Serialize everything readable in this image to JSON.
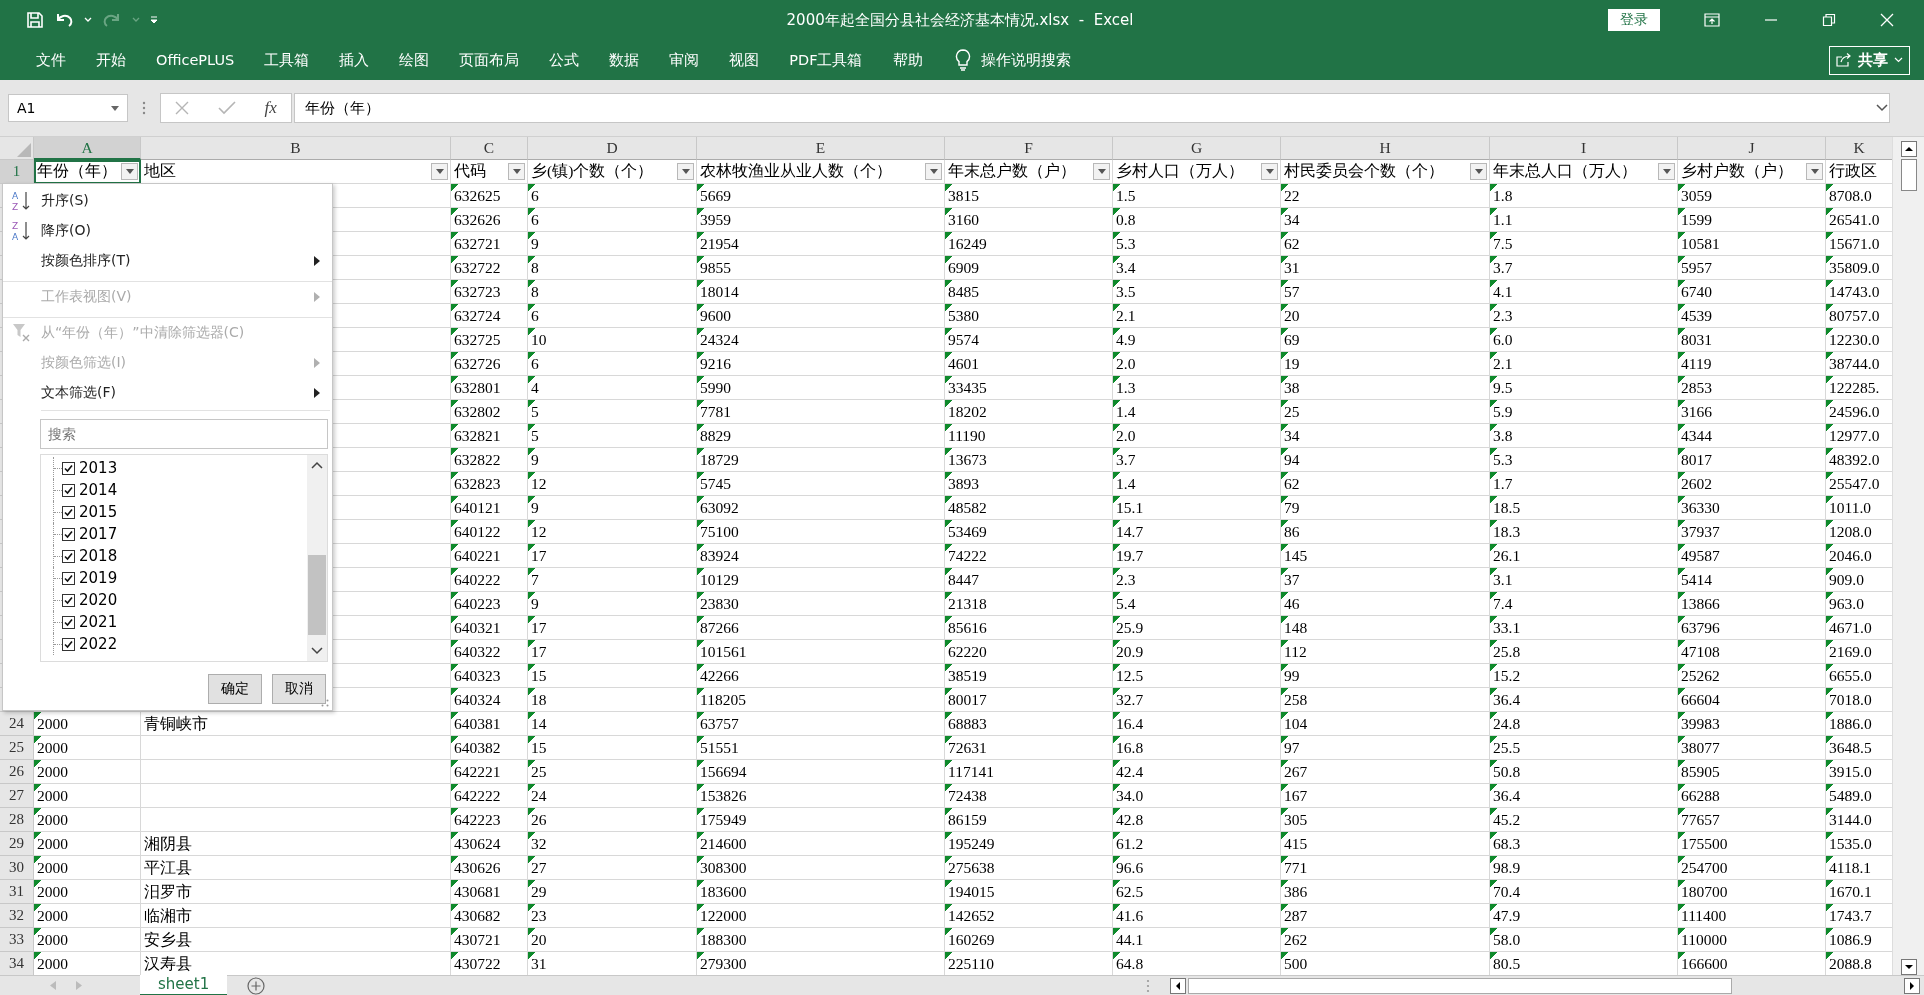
{
  "window": {
    "title": "2000年起全国分县社会经济基本情况.xlsx  -  Excel",
    "login": "登录"
  },
  "ribbon": {
    "tabs": [
      {
        "label": "文件",
        "selected": false
      },
      {
        "label": "开始",
        "selected": false
      },
      {
        "label": "OfficePLUS",
        "selected": false
      },
      {
        "label": "工具箱",
        "selected": false
      },
      {
        "label": "插入",
        "selected": false
      },
      {
        "label": "绘图",
        "selected": false
      },
      {
        "label": "页面布局",
        "selected": false
      },
      {
        "label": "公式",
        "selected": false
      },
      {
        "label": "数据",
        "selected": false
      },
      {
        "label": "审阅",
        "selected": false
      },
      {
        "label": "视图",
        "selected": false
      },
      {
        "label": "PDF工具箱",
        "selected": false
      },
      {
        "label": "帮助",
        "selected": false
      }
    ],
    "tell_me": "操作说明搜索",
    "share": "共享"
  },
  "formula_bar": {
    "name_box": "A1",
    "fx": "fx",
    "formula": "年份（年）"
  },
  "columns": [
    {
      "letter": "A",
      "header": "年份（年）",
      "selected": true,
      "filter_button": true,
      "text_number": true
    },
    {
      "letter": "B",
      "header": "地区",
      "selected": false,
      "filter_button": true,
      "text_number": false
    },
    {
      "letter": "C",
      "header": "代码",
      "selected": false,
      "filter_button": true,
      "text_number": true
    },
    {
      "letter": "D",
      "header": "乡(镇)个数（个）",
      "selected": false,
      "filter_button": true,
      "text_number": true
    },
    {
      "letter": "E",
      "header": "农林牧渔业从业人数（个）",
      "selected": false,
      "filter_button": true,
      "text_number": true
    },
    {
      "letter": "F",
      "header": "年末总户数（户）",
      "selected": false,
      "filter_button": true,
      "text_number": true
    },
    {
      "letter": "G",
      "header": "乡村人口（万人）",
      "selected": false,
      "filter_button": true,
      "text_number": true
    },
    {
      "letter": "H",
      "header": "村民委员会个数（个）",
      "selected": false,
      "filter_button": true,
      "text_number": true
    },
    {
      "letter": "I",
      "header": "年末总人口（万人）",
      "selected": false,
      "filter_button": true,
      "text_number": true
    },
    {
      "letter": "J",
      "header": "乡村户数（户）",
      "selected": false,
      "filter_button": true,
      "text_number": true
    },
    {
      "letter": "K",
      "header": "行政区",
      "selected": false,
      "text_number": true
    }
  ],
  "header_row_number": "1",
  "rows": [
    {
      "values": [
        "632625",
        "6",
        "5669",
        "3815",
        "1.5",
        "22",
        "1.8",
        "3059",
        "8708.0"
      ]
    },
    {
      "values": [
        "632626",
        "6",
        "3959",
        "3160",
        "0.8",
        "34",
        "1.1",
        "1599",
        "26541.0"
      ]
    },
    {
      "values": [
        "632721",
        "9",
        "21954",
        "16249",
        "5.3",
        "62",
        "7.5",
        "10581",
        "15671.0"
      ]
    },
    {
      "values": [
        "632722",
        "8",
        "9855",
        "6909",
        "3.4",
        "31",
        "3.7",
        "5957",
        "35809.0"
      ]
    },
    {
      "values": [
        "632723",
        "8",
        "18014",
        "8485",
        "3.5",
        "57",
        "4.1",
        "6740",
        "14743.0"
      ]
    },
    {
      "values": [
        "632724",
        "6",
        "9600",
        "5380",
        "2.1",
        "20",
        "2.3",
        "4539",
        "80757.0"
      ]
    },
    {
      "values": [
        "632725",
        "10",
        "24324",
        "9574",
        "4.9",
        "69",
        "6.0",
        "8031",
        "12230.0"
      ]
    },
    {
      "values": [
        "632726",
        "6",
        "9216",
        "4601",
        "2.0",
        "19",
        "2.1",
        "4119",
        "38744.0"
      ]
    },
    {
      "values": [
        "632801",
        "4",
        "5990",
        "33435",
        "1.3",
        "38",
        "9.5",
        "2853",
        "122285."
      ]
    },
    {
      "values": [
        "632802",
        "5",
        "7781",
        "18202",
        "1.4",
        "25",
        "5.9",
        "3166",
        "24596.0"
      ]
    },
    {
      "values": [
        "632821",
        "5",
        "8829",
        "11190",
        "2.0",
        "34",
        "3.8",
        "4344",
        "12977.0"
      ]
    },
    {
      "values": [
        "632822",
        "9",
        "18729",
        "13673",
        "3.7",
        "94",
        "5.3",
        "8017",
        "48392.0"
      ]
    },
    {
      "values": [
        "632823",
        "12",
        "5745",
        "3893",
        "1.4",
        "62",
        "1.7",
        "2602",
        "25547.0"
      ]
    },
    {
      "values": [
        "640121",
        "9",
        "63092",
        "48582",
        "15.1",
        "79",
        "18.5",
        "36330",
        "1011.0"
      ]
    },
    {
      "values": [
        "640122",
        "12",
        "75100",
        "53469",
        "14.7",
        "86",
        "18.3",
        "37937",
        "1208.0"
      ]
    },
    {
      "values": [
        "640221",
        "17",
        "83924",
        "74222",
        "19.7",
        "145",
        "26.1",
        "49587",
        "2046.0"
      ]
    },
    {
      "values": [
        "640222",
        "7",
        "10129",
        "8447",
        "2.3",
        "37",
        "3.1",
        "5414",
        "909.0"
      ]
    },
    {
      "values": [
        "640223",
        "9",
        "23830",
        "21318",
        "5.4",
        "46",
        "7.4",
        "13866",
        "963.0"
      ]
    },
    {
      "values": [
        "640321",
        "17",
        "87266",
        "85616",
        "25.9",
        "148",
        "33.1",
        "63796",
        "4671.0"
      ]
    },
    {
      "values": [
        "640322",
        "17",
        "101561",
        "62220",
        "20.9",
        "112",
        "25.8",
        "47108",
        "2169.0"
      ]
    },
    {
      "values": [
        "640323",
        "15",
        "42266",
        "38519",
        "12.5",
        "99",
        "15.2",
        "25262",
        "6655.0"
      ]
    },
    {
      "values": [
        "640324",
        "18",
        "118205",
        "80017",
        "32.7",
        "258",
        "36.4",
        "66604",
        "7018.0"
      ]
    },
    {
      "number": "24",
      "year": "2000",
      "region": "青铜峡市",
      "values": [
        "640381",
        "14",
        "63757",
        "68883",
        "16.4",
        "104",
        "24.8",
        "39983",
        "1886.0"
      ]
    },
    {
      "number": "25",
      "year": "2000",
      "values": [
        "640382",
        "15",
        "51551",
        "72631",
        "16.8",
        "97",
        "25.5",
        "38077",
        "3648.5"
      ]
    },
    {
      "number": "26",
      "year": "2000",
      "values": [
        "642221",
        "25",
        "156694",
        "117141",
        "42.4",
        "267",
        "50.8",
        "85905",
        "3915.0"
      ]
    },
    {
      "number": "27",
      "year": "2000",
      "values": [
        "642222",
        "24",
        "153826",
        "72438",
        "34.0",
        "167",
        "36.4",
        "66288",
        "5489.0"
      ]
    },
    {
      "number": "28",
      "year": "2000",
      "values": [
        "642223",
        "26",
        "175949",
        "86159",
        "42.8",
        "305",
        "45.2",
        "77657",
        "3144.0"
      ]
    },
    {
      "number": "29",
      "year": "2000",
      "region": "湘阴县",
      "values": [
        "430624",
        "32",
        "214600",
        "195249",
        "61.2",
        "415",
        "68.3",
        "175500",
        "1535.0"
      ]
    },
    {
      "number": "30",
      "year": "2000",
      "region": "平江县",
      "values": [
        "430626",
        "27",
        "308300",
        "275638",
        "96.6",
        "771",
        "98.9",
        "254700",
        "4118.1"
      ]
    },
    {
      "number": "31",
      "year": "2000",
      "region": "汨罗市",
      "values": [
        "430681",
        "29",
        "183600",
        "194015",
        "62.5",
        "386",
        "70.4",
        "180700",
        "1670.1"
      ]
    },
    {
      "number": "32",
      "year": "2000",
      "region": "临湘市",
      "values": [
        "430682",
        "23",
        "122000",
        "142652",
        "41.6",
        "287",
        "47.9",
        "111400",
        "1743.7"
      ]
    },
    {
      "number": "33",
      "year": "2000",
      "region": "安乡县",
      "values": [
        "430721",
        "20",
        "188300",
        "160269",
        "44.1",
        "262",
        "58.0",
        "110000",
        "1086.9"
      ]
    },
    {
      "number": "34",
      "year": "2000",
      "region": "汉寿县",
      "values": [
        "430722",
        "31",
        "279300",
        "225110",
        "64.8",
        "500",
        "80.5",
        "166600",
        "2088.8"
      ]
    }
  ],
  "filter_menu": {
    "items": [
      {
        "kind": "sort-ascending",
        "icon_text": [
          "A",
          "Z"
        ],
        "label": "升序(S)",
        "disabled": false,
        "submenu": false,
        "separator_before": false
      },
      {
        "kind": "sort-descending",
        "icon_text": [
          "Z",
          "A"
        ],
        "label": "降序(O)",
        "disabled": false,
        "submenu": false,
        "separator_before": false
      },
      {
        "kind": "plain",
        "label": "按颜色排序(T)",
        "disabled": false,
        "submenu": true,
        "separator_before": false
      },
      {
        "kind": "plain",
        "label": "工作表视图(V)",
        "disabled": true,
        "submenu": true,
        "separator_before": true
      },
      {
        "kind": "clear-filter",
        "label": "从“年份（年）”中清除筛选器(C)",
        "disabled": true,
        "submenu": false,
        "separator_before": true
      },
      {
        "kind": "plain",
        "label": "按颜色筛选(I)",
        "disabled": true,
        "submenu": true,
        "separator_before": false
      },
      {
        "kind": "plain",
        "label": "文本筛选(F)",
        "disabled": false,
        "submenu": true,
        "separator_before": false
      }
    ],
    "search_placeholder": "搜索",
    "options": [
      {
        "label": "2013",
        "checked": true
      },
      {
        "label": "2014",
        "checked": true
      },
      {
        "label": "2015",
        "checked": true
      },
      {
        "label": "2017",
        "checked": true
      },
      {
        "label": "2018",
        "checked": true
      },
      {
        "label": "2019",
        "checked": true
      },
      {
        "label": "2020",
        "checked": true
      },
      {
        "label": "2021",
        "checked": true
      },
      {
        "label": "2022",
        "checked": true
      }
    ],
    "buttons": [
      "确定",
      "取消"
    ]
  },
  "sheets": [
    {
      "label": "sheet1",
      "selected": true
    }
  ]
}
